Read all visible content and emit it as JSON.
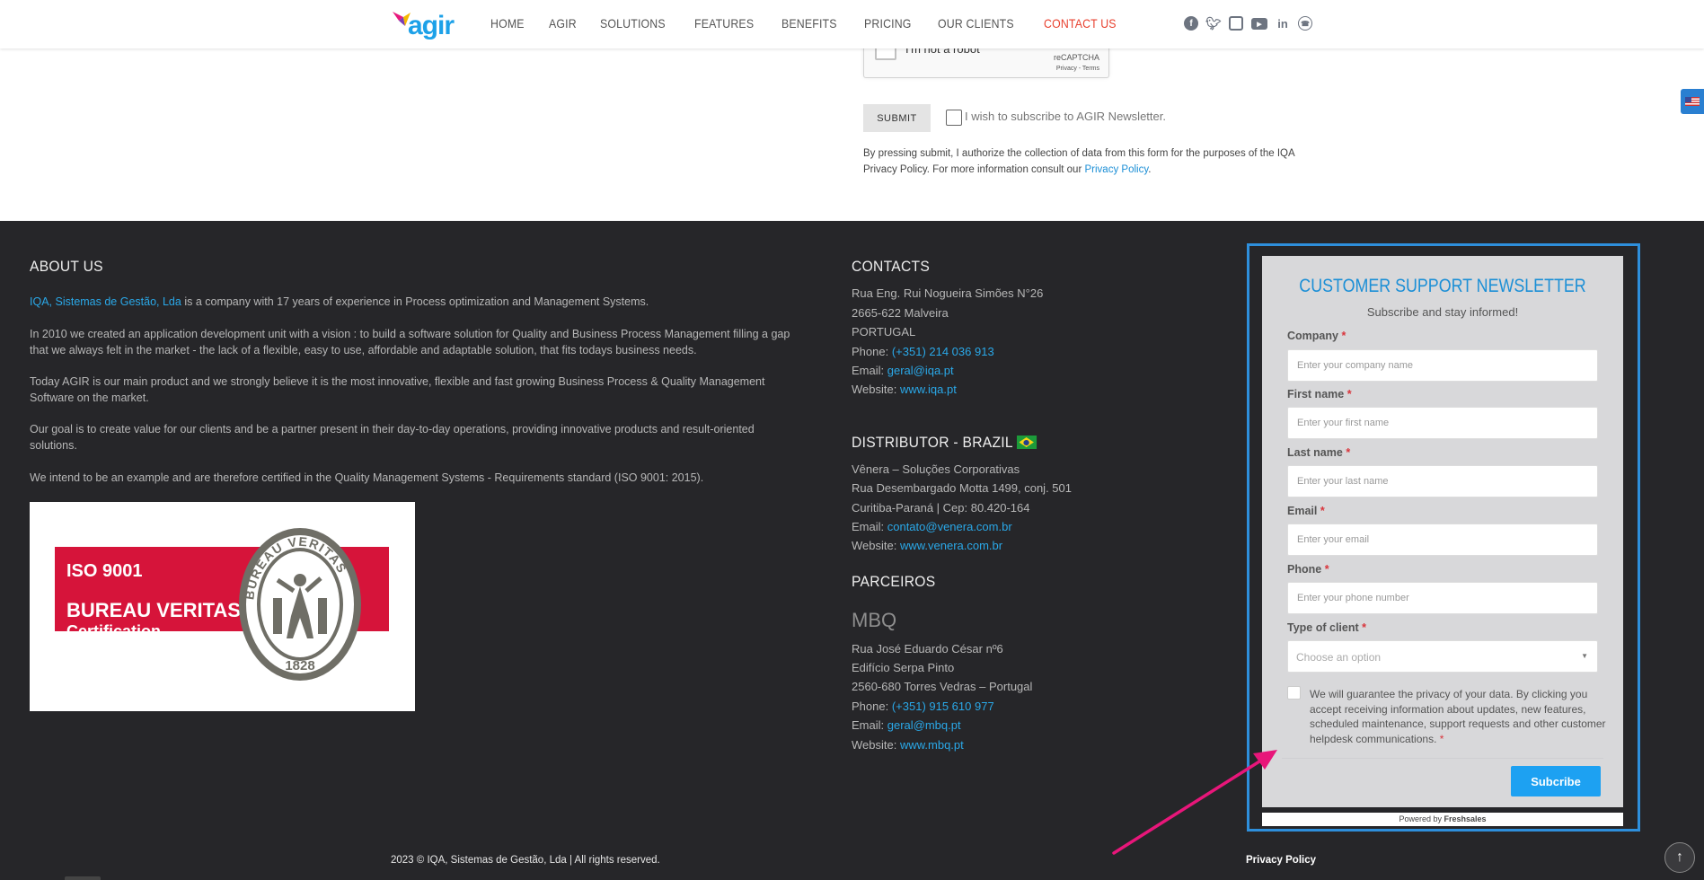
{
  "nav": {
    "logo_text": "agir",
    "items": [
      {
        "label": "HOME",
        "active": false
      },
      {
        "label": "AGIR",
        "active": false
      },
      {
        "label": "SOLUTIONS",
        "active": false
      },
      {
        "label": "FEATURES",
        "active": false
      },
      {
        "label": "BENEFITS",
        "active": false
      },
      {
        "label": "PRICING",
        "active": false
      },
      {
        "label": "OUR CLIENTS",
        "active": false
      },
      {
        "label": "CONTACT US",
        "active": true
      }
    ],
    "socials": [
      "facebook-icon",
      "twitter-icon",
      "instagram-icon",
      "youtube-icon",
      "linkedin-icon",
      "whatsapp-icon"
    ]
  },
  "contact_form": {
    "recaptcha_label": "I'm not a robot",
    "recaptcha_brand": "reCAPTCHA",
    "recaptcha_terms": "Privacy - Terms",
    "submit_label": "SUBMIT",
    "newsletter_label": "I wish to subscribe to AGIR Newsletter.",
    "auth_text": "By pressing submit, I authorize the collection of data from this form for the purposes of the IQA Privacy Policy. For more information consult our",
    "auth_link": "Privacy Policy",
    "auth_end": "."
  },
  "about": {
    "heading": "ABOUT US",
    "p1_link": "IQA, Sistemas de Gestão, Lda",
    "p1_rest": " is a company with 17 years of experience in Process optimization and Management Systems.",
    "p2": "In 2010 we created an application development unit with a vision : to build a software solution for Quality and Business Process Management filling a gap that we always felt in the market - the lack of a flexible, easy to use, affordable and adaptable solution, that fits todays business needs.",
    "p3": "Today AGIR is our main product and we strongly believe it is the most innovative, flexible and fast growing Business Process & Quality Management Software on the market.",
    "p4": "Our goal is to create value for our clients and be a partner present in their day-to-day operations, providing innovative products and result-oriented solutions.",
    "p5": "We intend to be an example and are therefore certified in the Quality Management Systems - Requirements standard (ISO 9001: 2015).",
    "iso_line1": "ISO 9001",
    "iso_line2": "BUREAU VERITAS",
    "iso_line3": "Certification",
    "seal_top": "BUREAU VERITAS",
    "seal_year": "1828"
  },
  "contacts": {
    "heading": "CONTACTS",
    "address1": "Rua Eng. Rui Nogueira Simões N°26",
    "address2": "2665-622 Malveira",
    "country": "PORTUGAL",
    "phone_label": "Phone: ",
    "phone": "(+351) 214 036 913",
    "email_label": "Email: ",
    "email": "geral@iqa.pt",
    "website_label": "Website: ",
    "website": "www.iqa.pt"
  },
  "distributor": {
    "heading": "DISTRIBUTOR - BRAZIL",
    "name": "Vênera – Soluções Corporativas",
    "address1": "Rua Desembargado Motta 1499, conj. 501",
    "address2": "Curitiba-Paraná | Cep: 80.420-164",
    "email_label": "Email: ",
    "email": "contato@venera.com.br",
    "website_label": "Website: ",
    "website": "www.venera.com.br"
  },
  "partners": {
    "heading": "PARCEIROS",
    "name": "MBQ",
    "address1": "Rua José Eduardo César nº6",
    "address2": "Edifício Serpa Pinto",
    "address3": "2560-680 Torres Vedras – Portugal",
    "phone_label": "Phone: ",
    "phone": "(+351) 915 610 977",
    "email_label": "Email: ",
    "email": "geral@mbq.pt",
    "website_label": "Website: ",
    "website": "www.mbq.pt"
  },
  "newsletter": {
    "title": "CUSTOMER SUPPORT NEWSLETTER",
    "subtitle": "Subscribe and stay informed!",
    "req_mark": "*",
    "fields": [
      {
        "label": "Company",
        "placeholder": "Enter your company name"
      },
      {
        "label": "First name",
        "placeholder": "Enter your first name"
      },
      {
        "label": "Last name",
        "placeholder": "Enter your last name"
      },
      {
        "label": "Email",
        "placeholder": "Enter your email"
      },
      {
        "label": "Phone",
        "placeholder": "Enter your phone number"
      }
    ],
    "client_type_label": "Type of client",
    "client_type_value": "Choose an option",
    "consent": "We will guarantee the privacy of your data. By clicking you accept receiving information about updates, new features, scheduled maintenance, support requests and other customer helpdesk communications.",
    "subscribe_label": "Subcribe",
    "powered_prefix": "Powered by ",
    "powered_brand": "Freshsales",
    "accent_color": "#1da1f2",
    "frame_color": "#2e8fdc"
  },
  "footer": {
    "copyright": "2023 © IQA, Sistemas de Gestão, Lda | All rights reserved.",
    "privacy": "Privacy Policy"
  }
}
